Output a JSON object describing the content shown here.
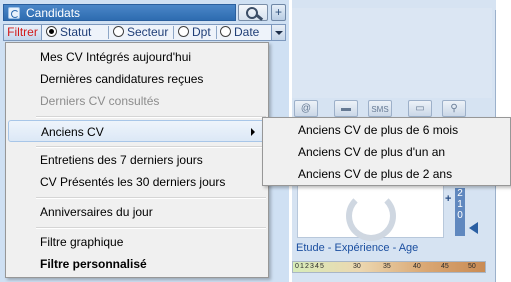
{
  "header": {
    "title": "Candidats",
    "search_icon": "search-icon",
    "plus_label": "+"
  },
  "filter_bar": {
    "filter_label": "Filtrer",
    "options": [
      "Statut",
      "Secteur",
      "Dpt",
      "Date"
    ],
    "selected": "Statut"
  },
  "menu": {
    "items": [
      {
        "label": "Mes CV Intégrés aujourd'hui"
      },
      {
        "label": "Dernières candidatures reçues"
      },
      {
        "label": "Derniers CV consultés",
        "disabled": true
      },
      {
        "label": "Anciens CV",
        "submenu": true
      },
      {
        "label": "Entretiens des 7 derniers jours"
      },
      {
        "label": "CV Présentés les 30 derniers jours"
      },
      {
        "label": "Anniversaires du jour"
      },
      {
        "label": "Filtre graphique"
      },
      {
        "label": "Filtre personnalisé",
        "bold": true
      }
    ]
  },
  "submenu": {
    "items": [
      {
        "label": "Anciens CV de plus de 6 mois"
      },
      {
        "label": "Anciens CV de plus d'un an"
      },
      {
        "label": "Anciens CV de plus de 2 ans"
      }
    ]
  },
  "right_panel": {
    "toolbar_icons": [
      "email-icon",
      "card-icon",
      "sms-icon",
      "print-icon",
      "search-icon"
    ],
    "sms_label": "SMS",
    "rank_plus": "+",
    "rank_digits": [
      "2",
      "1",
      "0"
    ],
    "section_label": "Etude - Expérience - Age",
    "scale_labels": [
      "0",
      "1",
      "2",
      "3",
      "4",
      "5",
      "30",
      "35",
      "40",
      "45",
      "50"
    ]
  }
}
